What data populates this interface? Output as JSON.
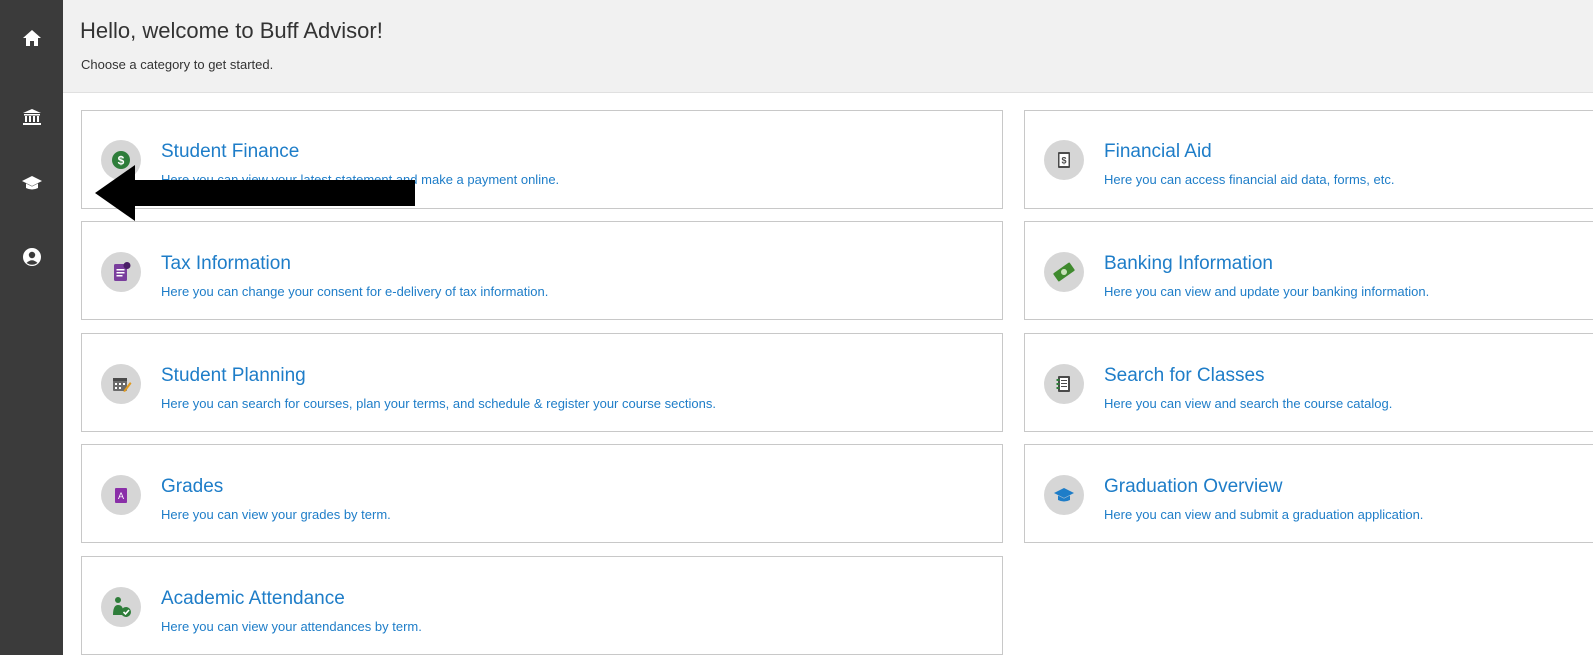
{
  "sidebar": {
    "items": [
      {
        "name": "home",
        "icon": "home-icon"
      },
      {
        "name": "finance",
        "icon": "bank-icon"
      },
      {
        "name": "academics",
        "icon": "graduation-cap-icon"
      },
      {
        "name": "profile",
        "icon": "user-circle-icon"
      }
    ]
  },
  "header": {
    "title": "Hello, welcome to Buff Advisor!",
    "subtitle": "Choose a category to get started."
  },
  "cards": [
    {
      "title": "Student Finance",
      "desc": "Here you can view your latest statement and make a payment online.",
      "icon": "dollar-coin-icon"
    },
    {
      "title": "Financial Aid",
      "desc": "Here you can access financial aid data, forms, etc.",
      "icon": "dollar-document-icon"
    },
    {
      "title": "Tax Information",
      "desc": "Here you can change your consent for e-delivery of tax information.",
      "icon": "tax-document-icon"
    },
    {
      "title": "Banking Information",
      "desc": "Here you can view and update your banking information.",
      "icon": "money-icon"
    },
    {
      "title": "Student Planning",
      "desc": "Here you can search for courses, plan your terms, and schedule & register your course sections.",
      "icon": "calendar-edit-icon"
    },
    {
      "title": "Search for Classes",
      "desc": "Here you can view and search the course catalog.",
      "icon": "catalog-book-icon"
    },
    {
      "title": "Grades",
      "desc": "Here you can view your grades by term.",
      "icon": "grade-book-icon"
    },
    {
      "title": "Graduation Overview",
      "desc": "Here you can view and submit a graduation application.",
      "icon": "graduation-cap-icon"
    },
    {
      "title": "Academic Attendance",
      "desc": "Here you can view your attendances by term.",
      "icon": "attendance-check-icon"
    }
  ],
  "colors": {
    "sidebar": "#3b3b3b",
    "link": "#1e7dc8",
    "header_bg": "#f1f1f1"
  }
}
